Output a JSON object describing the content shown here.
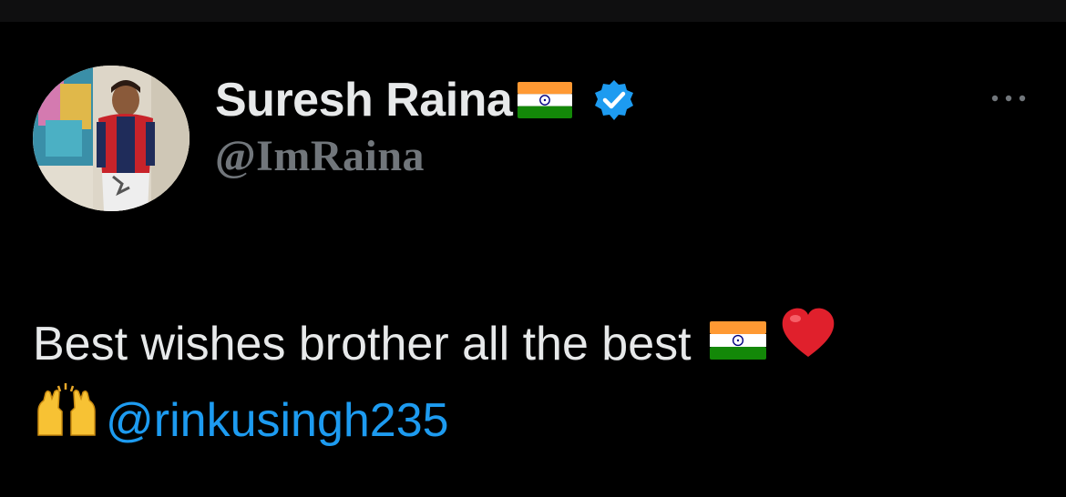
{
  "tweet": {
    "author": {
      "display_name": "Suresh Raina",
      "handle": "@ImRaina",
      "verified": true,
      "name_emoji": "india-flag-icon"
    },
    "text": {
      "line1": "Best wishes brother all the best",
      "mention": "@rinkusingh235"
    },
    "emojis": [
      "india-flag-icon",
      "red-heart-icon",
      "raising-hands-icon"
    ]
  },
  "colors": {
    "background": "#000000",
    "text_primary": "#e7e9ea",
    "text_secondary": "#71767b",
    "accent": "#1d9bf0"
  }
}
